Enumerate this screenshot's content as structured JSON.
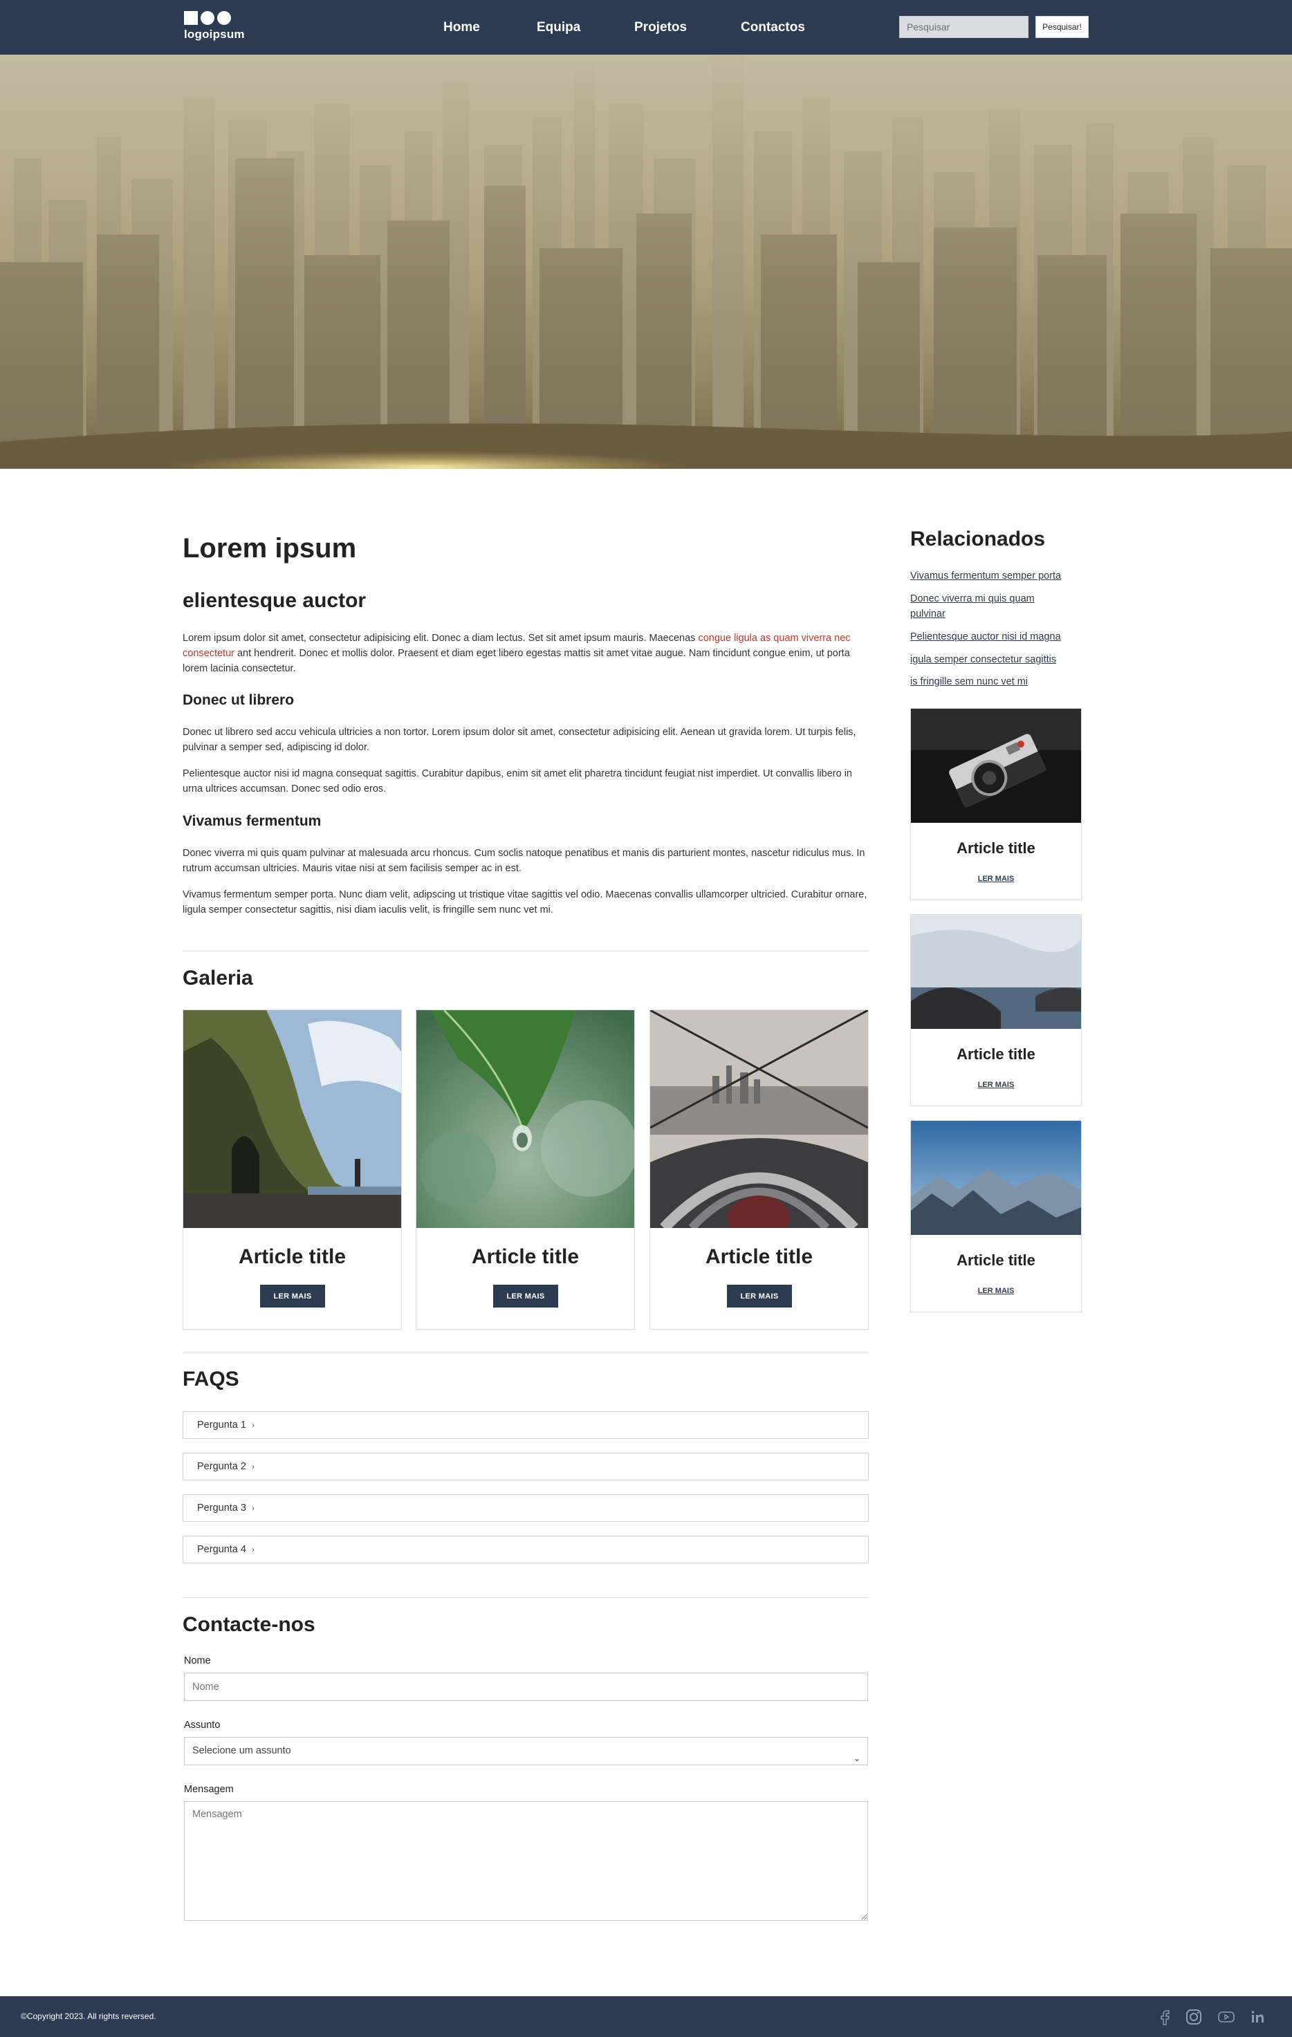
{
  "header": {
    "logo_text": "logoipsum",
    "nav": [
      "Home",
      "Equipa",
      "Projetos",
      "Contactos"
    ],
    "search_placeholder": "Pesquisar",
    "search_button": "Pesquisar!"
  },
  "main": {
    "title": "Lorem ipsum",
    "subtitle": "elientesque auctor",
    "intro_before_link": "Lorem ipsum dolor sit amet, consectetur adipisicing elit. Donec a diam lectus. Set sit amet ipsum mauris. Maecenas ",
    "intro_link": "congue ligula as quam viverra nec consectetur",
    "intro_after_link": " ant hendrerit. Donec et mollis dolor. Praesent et diam eget libero egestas mattis sit amet vitae augue. Nam tincidunt congue enim, ut porta lorem lacinia consectetur.",
    "section1_title": "Donec ut librero",
    "section1_p1": "Donec ut librero sed accu vehicula ultricies a non tortor. Lorem ipsum dolor sit amet, consectetur adipisicing elit. Aenean ut gravida lorem. Ut turpis felis, pulvinar a semper sed, adipiscing id dolor.",
    "section1_p2": "Pelientesque auctor nisi id magna consequat sagittis. Curabitur dapibus, enim sit amet elit pharetra tincidunt feugiat nist imperdiet. Ut convallis libero in urna ultrices accumsan. Donec sed odio eros.",
    "section2_title": "Vivamus fermentum",
    "section2_p1": "Donec viverra mi quis quam pulvinar at malesuada arcu rhoncus. Cum soclis natoque penatibus et manis dis parturient montes, nascetur ridiculus mus. In rutrum accumsan ultricies. Mauris vitae nisi at sem facilisis semper ac in est.",
    "section2_p2": "Vivamus fermentum semper porta. Nunc diam velit, adipscing ut tristique vitae sagittis vel odio. Maecenas convallis ullamcorper ultricied. Curabitur ornare, ligula semper consectetur sagittis, nisi diam iaculis velit, is fringille sem nunc vet mi."
  },
  "gallery": {
    "title": "Galeria",
    "cards": [
      {
        "title": "Article title",
        "button": "LER MAIS"
      },
      {
        "title": "Article title",
        "button": "LER MAIS"
      },
      {
        "title": "Article title",
        "button": "LER MAIS"
      }
    ]
  },
  "faqs": {
    "title": "FAQS",
    "items": [
      "Pergunta 1",
      "Pergunta 2",
      "Pergunta 3",
      "Pergunta 4"
    ]
  },
  "contact": {
    "title": "Contacte-nos",
    "name_label": "Nome",
    "name_placeholder": "Nome",
    "subject_label": "Assunto",
    "subject_selected": "Selecione um assunto",
    "message_label": "Mensagem",
    "message_placeholder": "Mensagem"
  },
  "sidebar": {
    "title": "Relacionados",
    "links": [
      "Vivamus fermentum semper porta",
      "Donec viverra mi quis quam pulvinar",
      "Pelientesque auctor nisi id magna",
      "igula semper consectetur sagittis",
      "is fringille sem nunc vet mi"
    ],
    "cards": [
      {
        "title": "Article title",
        "link": "LER MAIS"
      },
      {
        "title": "Article title",
        "link": "LER MAIS"
      },
      {
        "title": "Article title",
        "link": "LER MAIS"
      }
    ]
  },
  "footer": {
    "copyright": "©Copyright 2023. All rights reversed.",
    "social_icons": [
      "facebook-icon",
      "instagram-icon",
      "youtube-icon",
      "linkedin-icon"
    ]
  },
  "colors": {
    "navy": "#2c3b51",
    "link_red": "#c0392b"
  }
}
